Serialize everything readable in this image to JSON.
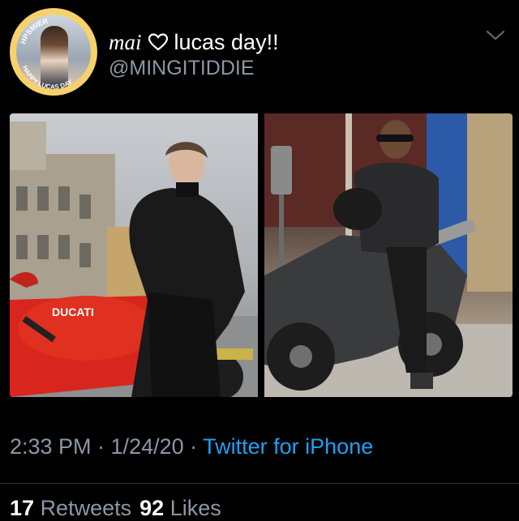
{
  "tweet": {
    "display_name_italic": "mai",
    "display_name_rest": "lucas day!!",
    "handle": "@MINGITIDDIE",
    "timestamp": "2:33 PM · 1/24/20 · ",
    "source": "Twitter for iPhone",
    "retweets_count": "17",
    "retweets_label": "Retweets",
    "likes_count": "92",
    "likes_label": "Likes"
  },
  "avatar": {
    "ring_text_top": "HPSMIER",
    "ring_text_bottom": "HAPPY LUCAS DAY"
  },
  "media": {
    "left_photo_brand_text": "DUCATI"
  },
  "icons": [
    "heart-icon",
    "chevron-down-icon"
  ],
  "colors": {
    "background": "#000000",
    "handle": "#8b98a5",
    "link": "#1da1f2",
    "avatar_ring": "#f7d26b"
  }
}
